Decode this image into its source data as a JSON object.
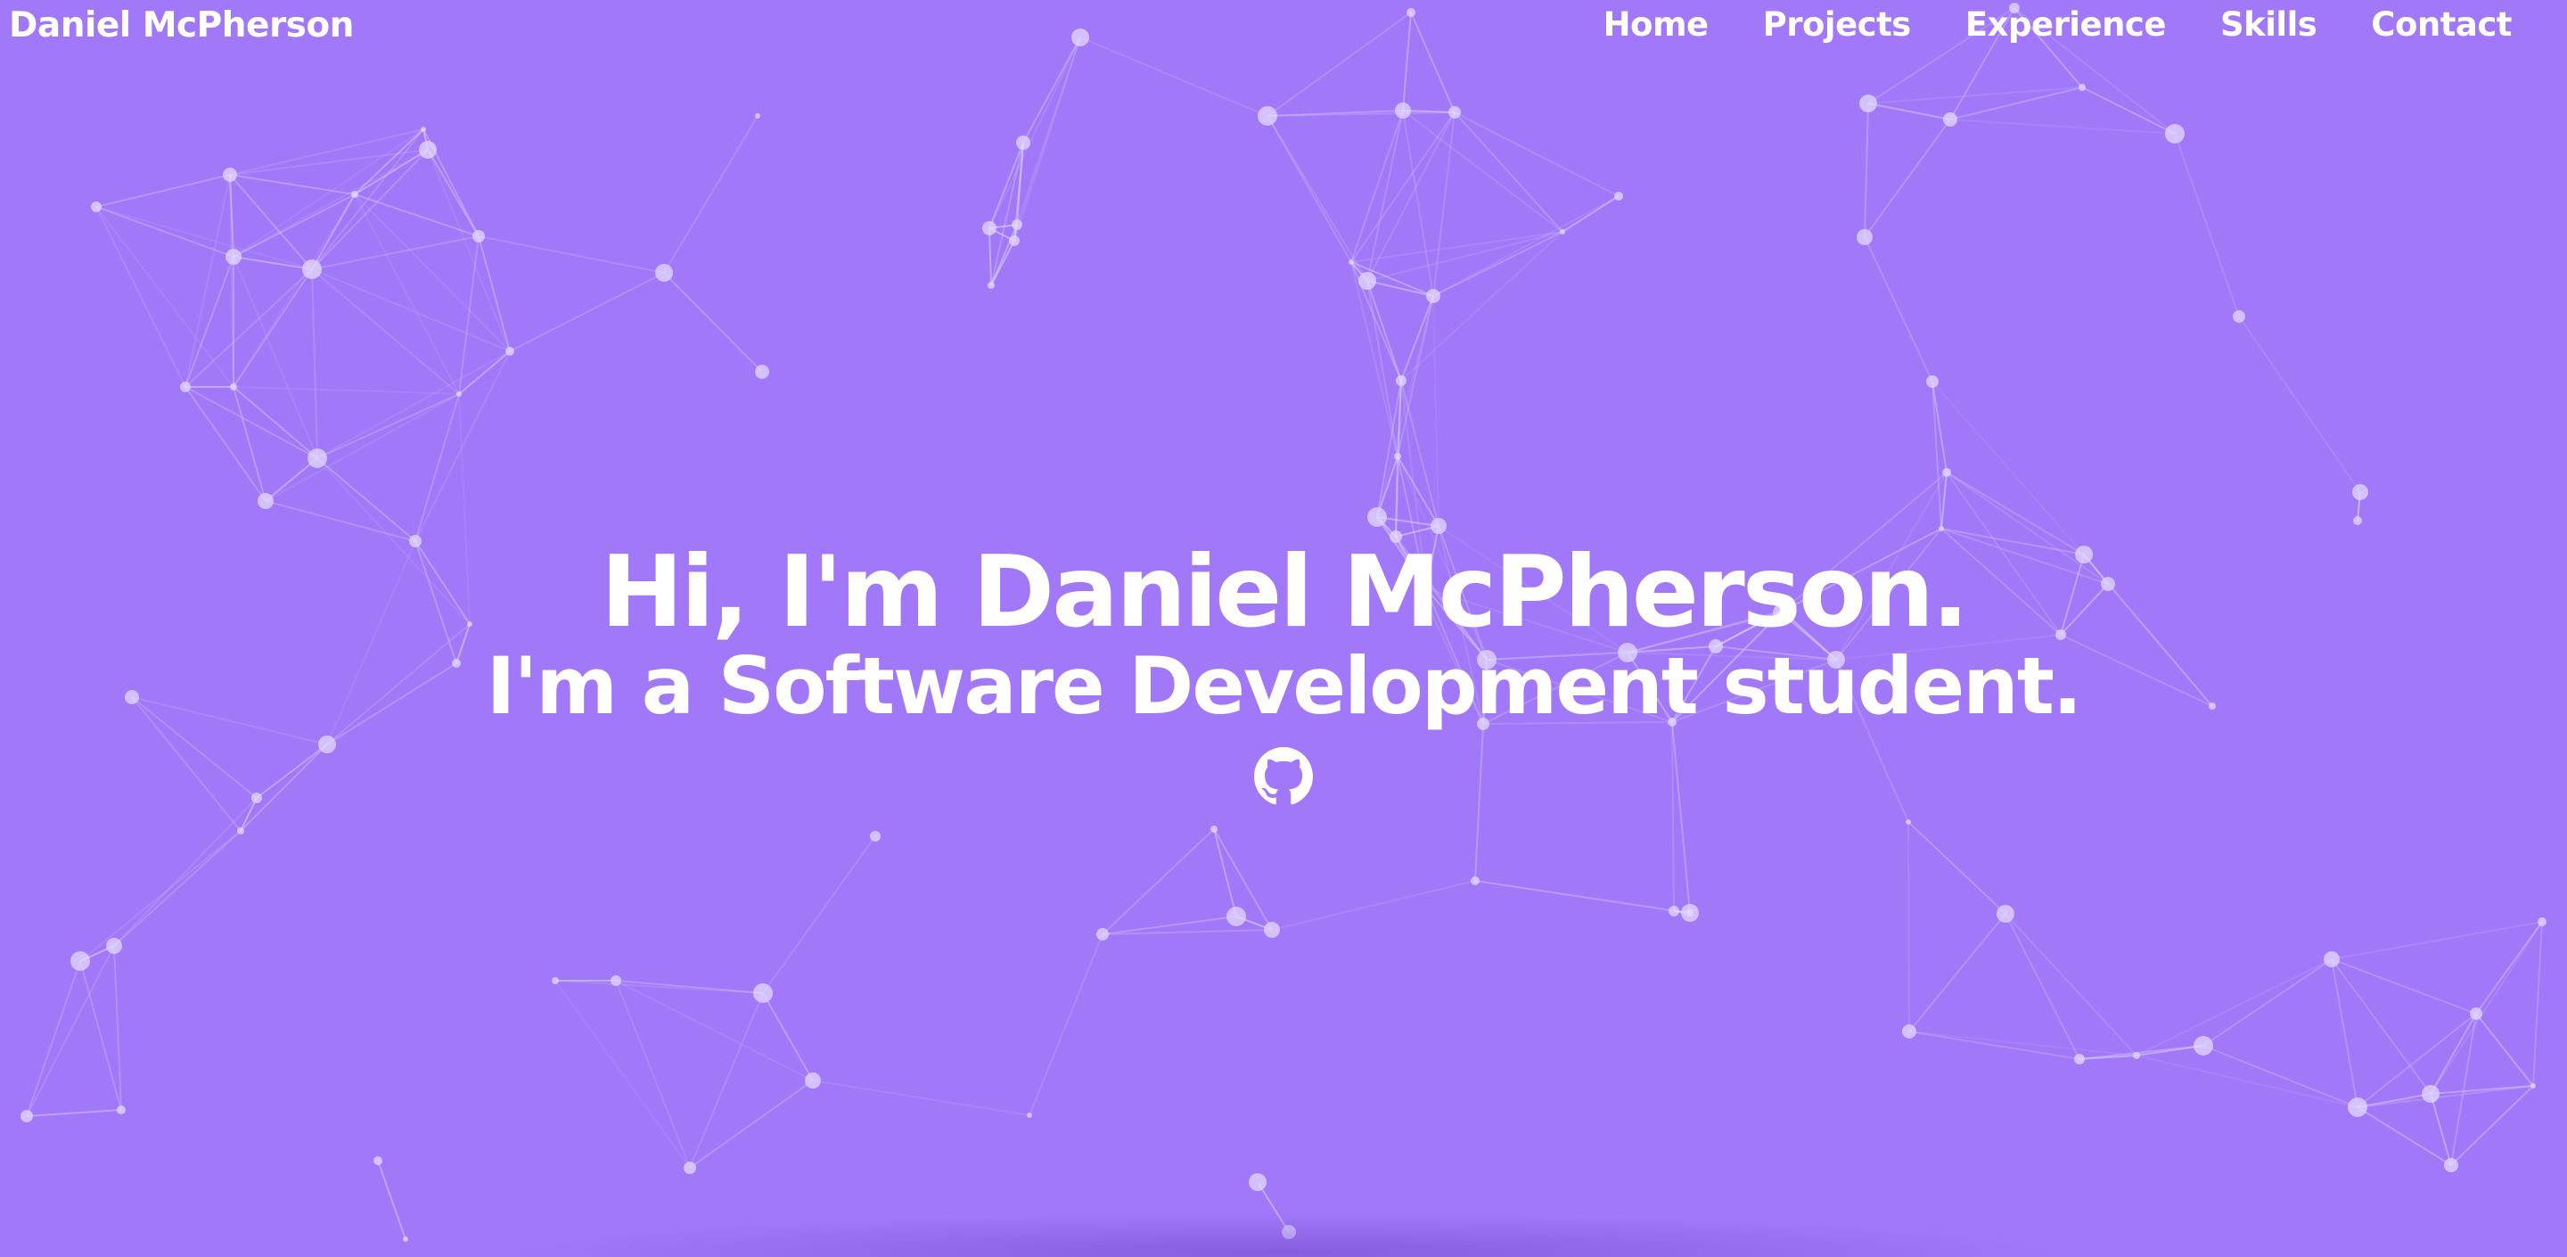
{
  "colors": {
    "background": "#a078f8",
    "text": "#ffffff",
    "particle": "#e4d9ff"
  },
  "navbar": {
    "brand": "Daniel McPherson",
    "links": [
      {
        "label": "Home"
      },
      {
        "label": "Projects"
      },
      {
        "label": "Experience"
      },
      {
        "label": "Skills"
      },
      {
        "label": "Contact"
      }
    ]
  },
  "hero": {
    "headline": "Hi, I'm Daniel McPherson.",
    "subheadline": "I'm a Software Development student.",
    "social_icon": "github-icon"
  }
}
